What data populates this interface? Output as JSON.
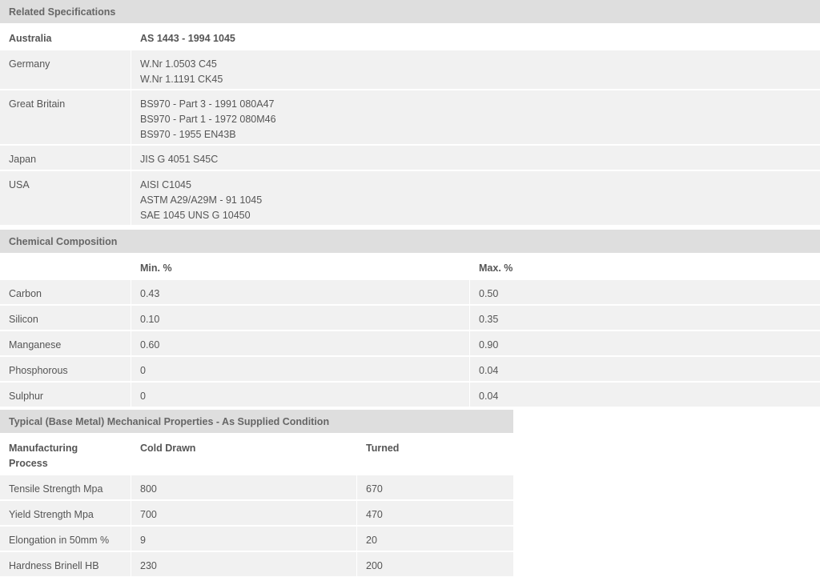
{
  "related": {
    "title": "Related Specifications",
    "rows": [
      {
        "country": "Australia",
        "specs": [
          "AS 1443 - 1994 1045"
        ]
      },
      {
        "country": "Germany",
        "specs": [
          "W.Nr 1.0503 C45",
          "W.Nr 1.1191 CK45"
        ]
      },
      {
        "country": "Great Britain",
        "specs": [
          "BS970 - Part 3 - 1991 080A47",
          "BS970 - Part 1 - 1972 080M46",
          "BS970 - 1955 EN43B"
        ]
      },
      {
        "country": "Japan",
        "specs": [
          "JIS G 4051 S45C"
        ]
      },
      {
        "country": "USA",
        "specs": [
          "AISI C1045",
          "ASTM A29/A29M - 91 1045",
          "SAE 1045 UNS G 10450"
        ]
      }
    ]
  },
  "chemical": {
    "title": "Chemical Composition",
    "headers": {
      "min": "Min. %",
      "max": "Max. %"
    },
    "rows": [
      {
        "element": "Carbon",
        "min": "0.43",
        "max": "0.50"
      },
      {
        "element": "Silicon",
        "min": "0.10",
        "max": "0.35"
      },
      {
        "element": "Manganese",
        "min": "0.60",
        "max": "0.90"
      },
      {
        "element": "Phosphorous",
        "min": "0",
        "max": "0.04"
      },
      {
        "element": "Sulphur",
        "min": "0",
        "max": "0.04"
      }
    ]
  },
  "mechanical": {
    "title": "Typical (Base Metal) Mechanical Properties - As Supplied Condition",
    "headers": {
      "process_line1": "Manufacturing",
      "process_line2": "Process",
      "cold": "Cold Drawn",
      "turned": "Turned"
    },
    "rows": [
      {
        "property": "Tensile Strength Mpa",
        "cold": "800",
        "turned": "670"
      },
      {
        "property": "Yield Strength Mpa",
        "cold": "700",
        "turned": "470"
      },
      {
        "property": "Elongation in 50mm %",
        "cold": "9",
        "turned": "20"
      },
      {
        "property": "Hardness Brinell HB",
        "cold": "230",
        "turned": "200"
      }
    ]
  }
}
